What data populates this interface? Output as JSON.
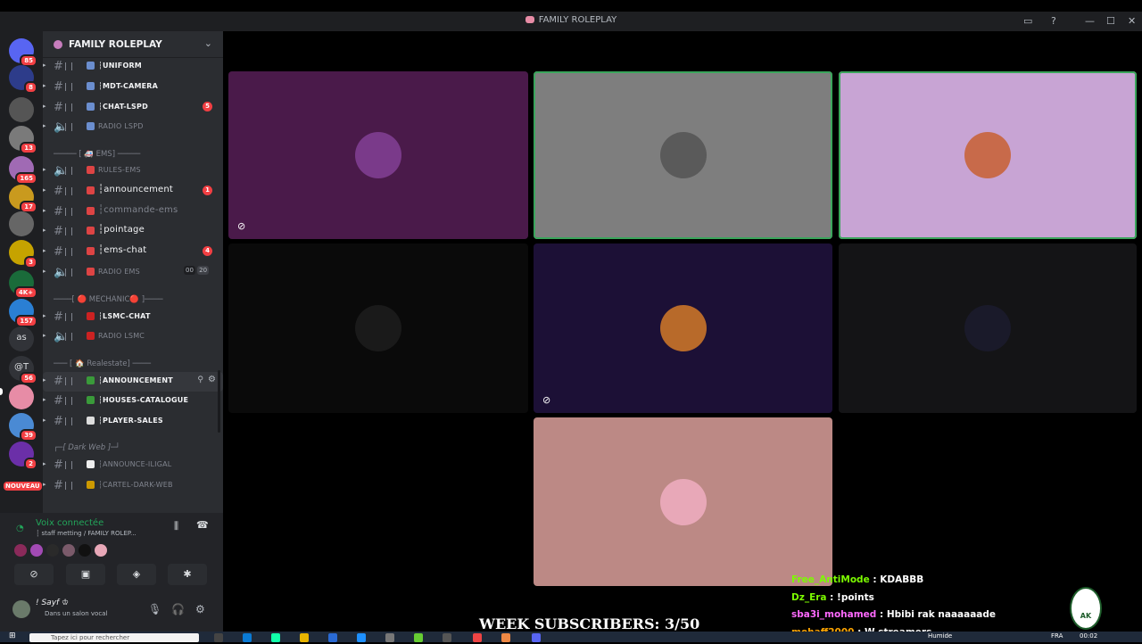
{
  "window": {
    "title": "FAMILY ROLEPLAY",
    "controls": [
      "▭",
      "?",
      "—",
      "☐",
      "✕"
    ]
  },
  "guilds": [
    {
      "badge": "85",
      "color": "#5865f2"
    },
    {
      "badge": "8",
      "color": "#2d3c8a"
    },
    {
      "badge": "",
      "color": "#555"
    },
    {
      "badge": "13",
      "color": "#7a7a7a"
    },
    {
      "badge": "165",
      "color": "#a06ab4"
    },
    {
      "badge": "17",
      "color": "#c99a1e"
    },
    {
      "badge": "",
      "color": "#666"
    },
    {
      "badge": "3",
      "color": "#c6a300"
    },
    {
      "badge": "4K+",
      "color": "#1a6b3a"
    },
    {
      "badge": "157",
      "color": "#2a7fd4"
    },
    {
      "badge": "",
      "label": "as",
      "color": "#313338"
    },
    {
      "badge": "56",
      "label": "@T",
      "color": "#313338"
    },
    {
      "badge": "",
      "color": "#e78ca6"
    },
    {
      "badge": "39",
      "color": "#4a8ad4"
    },
    {
      "badge": "2",
      "color": "#6b2fa8"
    }
  ],
  "new_badge": "NOUVEAU",
  "server": {
    "name": "FAMILY ROLEPLAY"
  },
  "channels": [
    {
      "label": "┆uniform",
      "style": "bold",
      "badge": ""
    },
    {
      "label": "┆mdt-camera",
      "style": "bold",
      "badge": ""
    },
    {
      "label": "┆chat-lspd",
      "style": "bold",
      "badge": "5"
    },
    {
      "label": "RADIO LSPD",
      "style": "muted",
      "badge": ""
    },
    {
      "label": "RULES-EMS",
      "style": "muted",
      "badge": ""
    },
    {
      "label": "┆announcement",
      "style": "big",
      "badge": "1"
    },
    {
      "label": "┆commande-ems",
      "style": "bigm",
      "badge": ""
    },
    {
      "label": "┆pointage",
      "style": "big",
      "badge": ""
    },
    {
      "label": "┆ems-chat",
      "style": "big",
      "badge": "4"
    },
    {
      "label": "RADIO EMS",
      "style": "muted",
      "badge": ""
    },
    {
      "label": "┆lsmc-chat",
      "style": "bold",
      "badge": ""
    },
    {
      "label": "RADIO LSMC",
      "style": "muted",
      "badge": ""
    },
    {
      "label": "┆announcement",
      "style": "bold",
      "badge": ""
    },
    {
      "label": "┆houses-catalogue",
      "style": "bold",
      "badge": ""
    },
    {
      "label": "┆player-sales",
      "style": "bold",
      "badge": ""
    },
    {
      "label": "┆announce-iligal",
      "style": "muted",
      "badge": ""
    },
    {
      "label": "┆cartel-dark-web",
      "style": "muted",
      "badge": ""
    }
  ],
  "categories": {
    "ems": "───── [ 🚑 EMS] ─────",
    "mechanic": "────[ 🔴 MECHANIC🔴 ]────",
    "realestate": "─── [ 🏠 Realestate] ────",
    "darkweb": "┌─[ Dark Web ]─┘"
  },
  "radio_ems_counts": {
    "current": "00",
    "max": "20"
  },
  "voice": {
    "status": "Voix connectée",
    "channel": "┆ staff metting / FAMILY ROLEP..."
  },
  "user": {
    "name": "! Sayf ♔",
    "status": "Dans un salon vocal"
  },
  "tiles": [
    {
      "bg": "#4a1a4a",
      "face": "#7a3a8a",
      "speaking": false,
      "muted": true
    },
    {
      "bg": "#7e7e7e",
      "face": "#5a5a5a",
      "speaking": true,
      "muted": false
    },
    {
      "bg": "#c8a4d4",
      "face": "#c86a4a",
      "speaking": true,
      "muted": false
    },
    {
      "bg": "#0a0a0a",
      "face": "#1a1a1a",
      "speaking": false,
      "muted": false
    },
    {
      "bg": "#1c1036",
      "face": "#b86a2a",
      "speaking": false,
      "muted": true
    },
    {
      "bg": "#141416",
      "face": "#1a1a2a",
      "speaking": false,
      "muted": false
    },
    {
      "bg": "#bc8985",
      "face": "#e8a8b8",
      "speaking": false,
      "muted": false
    }
  ],
  "chat_overlay": [
    {
      "user": "Free_AntiMode",
      "msg": " : KDABBB",
      "color": "#7cfc00"
    },
    {
      "user": "Dz_Era",
      "msg": " : !points",
      "color": "#7cfc00"
    },
    {
      "user": "sba3i_mohamed",
      "msg": " : Hbibi rak naaaaaade",
      "color": "#ff69ff"
    },
    {
      "user": "mohaff2000",
      "msg": " : W streamers",
      "color": "#ffa500"
    }
  ],
  "week_subs": "WEEK SUBSCRIBERS: 3/50",
  "ak_logo": "AK",
  "taskbar": {
    "search_placeholder": "Tapez ici pour rechercher",
    "time": "00:02",
    "lang": "FRA",
    "weather": "Humide"
  }
}
